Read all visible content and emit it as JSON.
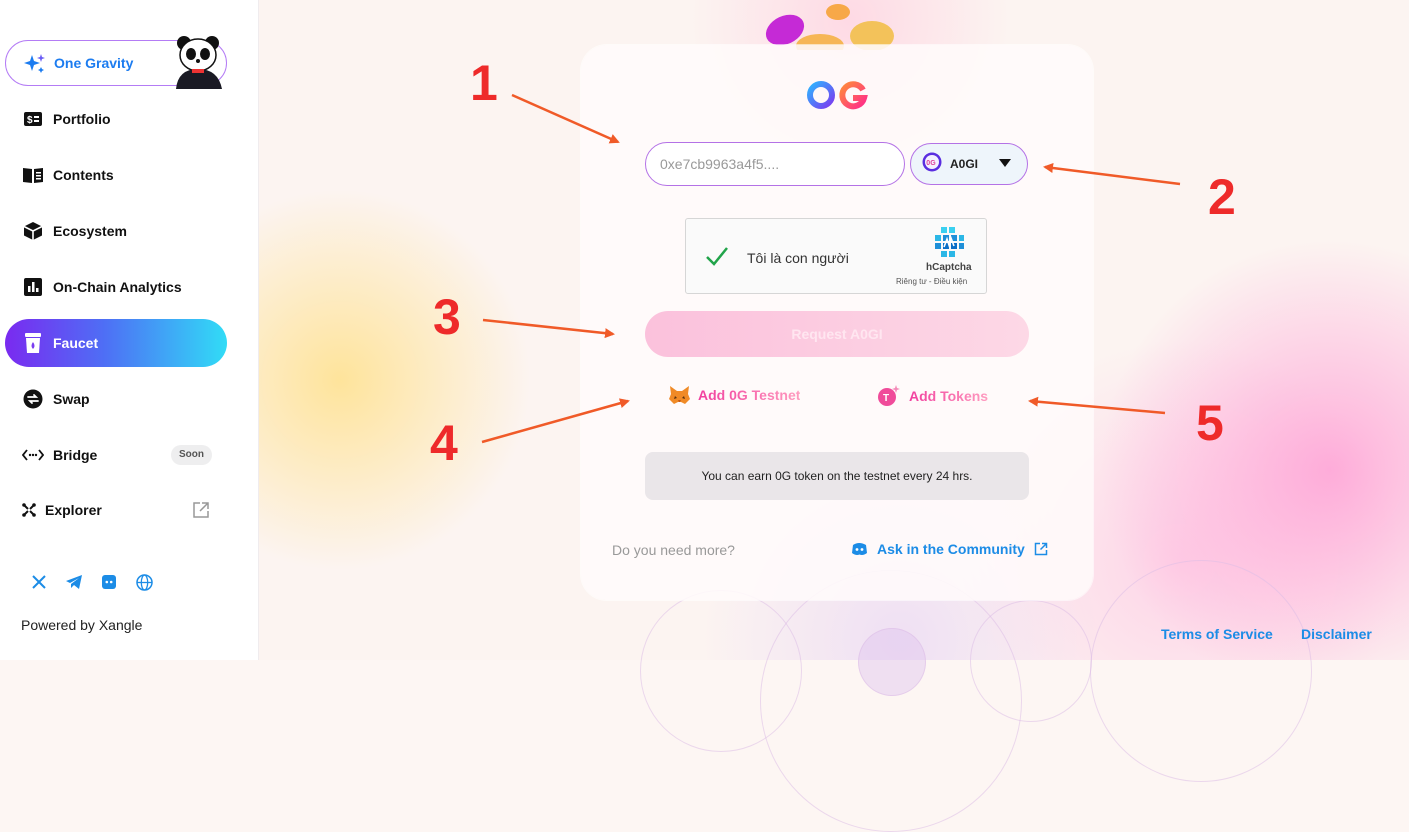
{
  "sidebar": {
    "brand_label": "One Gravity",
    "items": [
      {
        "label": "Portfolio"
      },
      {
        "label": "Contents"
      },
      {
        "label": "Ecosystem"
      },
      {
        "label": "On-Chain Analytics"
      },
      {
        "label": "Faucet"
      },
      {
        "label": "Swap"
      },
      {
        "label": "Bridge",
        "badge": "Soon"
      },
      {
        "label": "Explorer"
      }
    ],
    "powered_by": "Powered by Xangle"
  },
  "faucet": {
    "logo_text": "0G",
    "address_placeholder": "0xe7cb9963a4f5....",
    "token_selected": "A0GI",
    "captcha_text": "Tôi là con người",
    "captcha_brand": "hCaptcha",
    "captcha_links": "Riêng tư - Điều kiện",
    "request_label": "Request A0GI",
    "add_testnet_label": "Add 0G Testnet",
    "add_tokens_label": "Add Tokens",
    "info_text": "You can earn 0G token on the testnet every 24 hrs.",
    "need_more": "Do you need more?",
    "community_label": "Ask in the Community"
  },
  "footer": {
    "terms": "Terms of Service",
    "disclaimer": "Disclaimer"
  },
  "annotations": [
    "1",
    "2",
    "3",
    "4",
    "5"
  ],
  "colors": {
    "accent_blue": "#1c8ce6",
    "annotation_red": "#ee2a2a",
    "arrow_orange": "#f05a28",
    "active_gradient_start": "#7a2af0",
    "active_gradient_end": "#31dcf6"
  }
}
